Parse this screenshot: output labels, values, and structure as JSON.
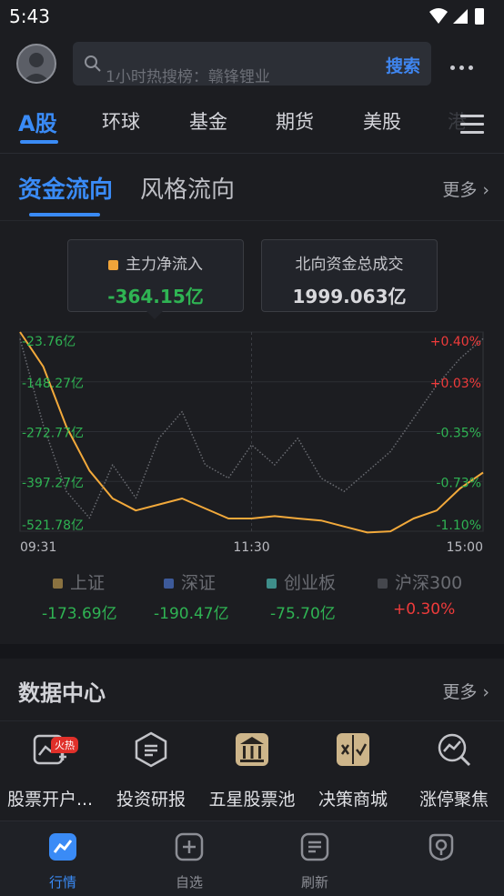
{
  "status_bar": {
    "time": "5:43"
  },
  "search": {
    "placeholder": "1小时热搜榜：赣锋锂业",
    "button_label": "搜索"
  },
  "market_tabs": [
    {
      "label": "A股",
      "active": true
    },
    {
      "label": "环球"
    },
    {
      "label": "基金"
    },
    {
      "label": "期货"
    },
    {
      "label": "美股"
    },
    {
      "label": "港"
    }
  ],
  "flow_tabs": {
    "active": "资金流向",
    "inactive": "风格流向",
    "more": "更多"
  },
  "cards": {
    "main_inflow": {
      "label": "主力净流入",
      "value": "-364.15亿",
      "dot_color": "#f0a43a",
      "value_color": "#2fb353"
    },
    "northbound": {
      "label": "北向资金总成交",
      "value": "1999.063亿"
    }
  },
  "chart_data": {
    "type": "line",
    "x_labels": [
      "09:31",
      "11:30",
      "15:00"
    ],
    "left_axis_labels": [
      "-23.76亿",
      "-148.27亿",
      "-272.77亿",
      "-397.27亿",
      "-521.78亿"
    ],
    "left_axis_values": [
      -23.76,
      -148.27,
      -272.77,
      -397.27,
      -521.78
    ],
    "right_axis_labels": [
      "+0.40%",
      "+0.03%",
      "-0.35%",
      "-0.73%",
      "-1.10%"
    ],
    "right_axis_values": [
      0.4,
      0.03,
      -0.35,
      -0.73,
      -1.1
    ],
    "grid": true,
    "series": [
      {
        "name": "主力净流入",
        "color": "#f2a93b",
        "style": "solid",
        "axis": "left",
        "values": [
          -23.76,
          -110,
          -260,
          -370,
          -440,
          -470,
          -455,
          -440,
          -465,
          -490,
          -490,
          -484,
          -490,
          -495,
          -510,
          -525,
          -522,
          -490,
          -470,
          -415,
          -375
        ]
      },
      {
        "name": "沪深300",
        "color": "#6a6c72",
        "style": "dotted",
        "axis": "right",
        "values": [
          0.35,
          -0.3,
          -0.8,
          -1.0,
          -0.6,
          -0.85,
          -0.4,
          -0.2,
          -0.6,
          -0.7,
          -0.45,
          -0.6,
          -0.4,
          -0.7,
          -0.8,
          -0.65,
          -0.5,
          -0.25,
          0.0,
          0.2,
          0.35
        ]
      }
    ]
  },
  "indices": [
    {
      "label": "上证",
      "value": "-173.69亿",
      "color": "#8a7240",
      "value_color": "#2fb353"
    },
    {
      "label": "深证",
      "value": "-190.47亿",
      "color": "#3d5a9a",
      "value_color": "#2fb353"
    },
    {
      "label": "创业板",
      "value": "-75.70亿",
      "color": "#3e8e8a",
      "value_color": "#2fb353"
    },
    {
      "label": "沪深300",
      "value": "+0.30%",
      "color": "#45474d",
      "value_color": "#ef3b3b"
    }
  ],
  "data_center": {
    "title": "数据中心",
    "more": "更多"
  },
  "tools": [
    {
      "label": "股票开户...",
      "icon": "chart-plus-icon",
      "badge": "火热"
    },
    {
      "label": "投资研报",
      "icon": "hexagon-doc-icon"
    },
    {
      "label": "五星股票池",
      "icon": "gold-building-icon"
    },
    {
      "label": "决策商城",
      "icon": "gold-bag-icon"
    },
    {
      "label": "涨停聚焦",
      "icon": "chart-search-icon"
    }
  ],
  "bottom_nav": [
    {
      "label": "行情",
      "icon": "chart-icon",
      "active": true
    },
    {
      "label": "自选",
      "icon": "plus-square-icon"
    },
    {
      "label": "刷新",
      "icon": "list-doc-icon"
    },
    {
      "label": "",
      "icon": "profile-icon"
    }
  ],
  "colors": {
    "accent": "#3a8bf6",
    "down": "#2fb353",
    "up": "#ef3b3b"
  }
}
